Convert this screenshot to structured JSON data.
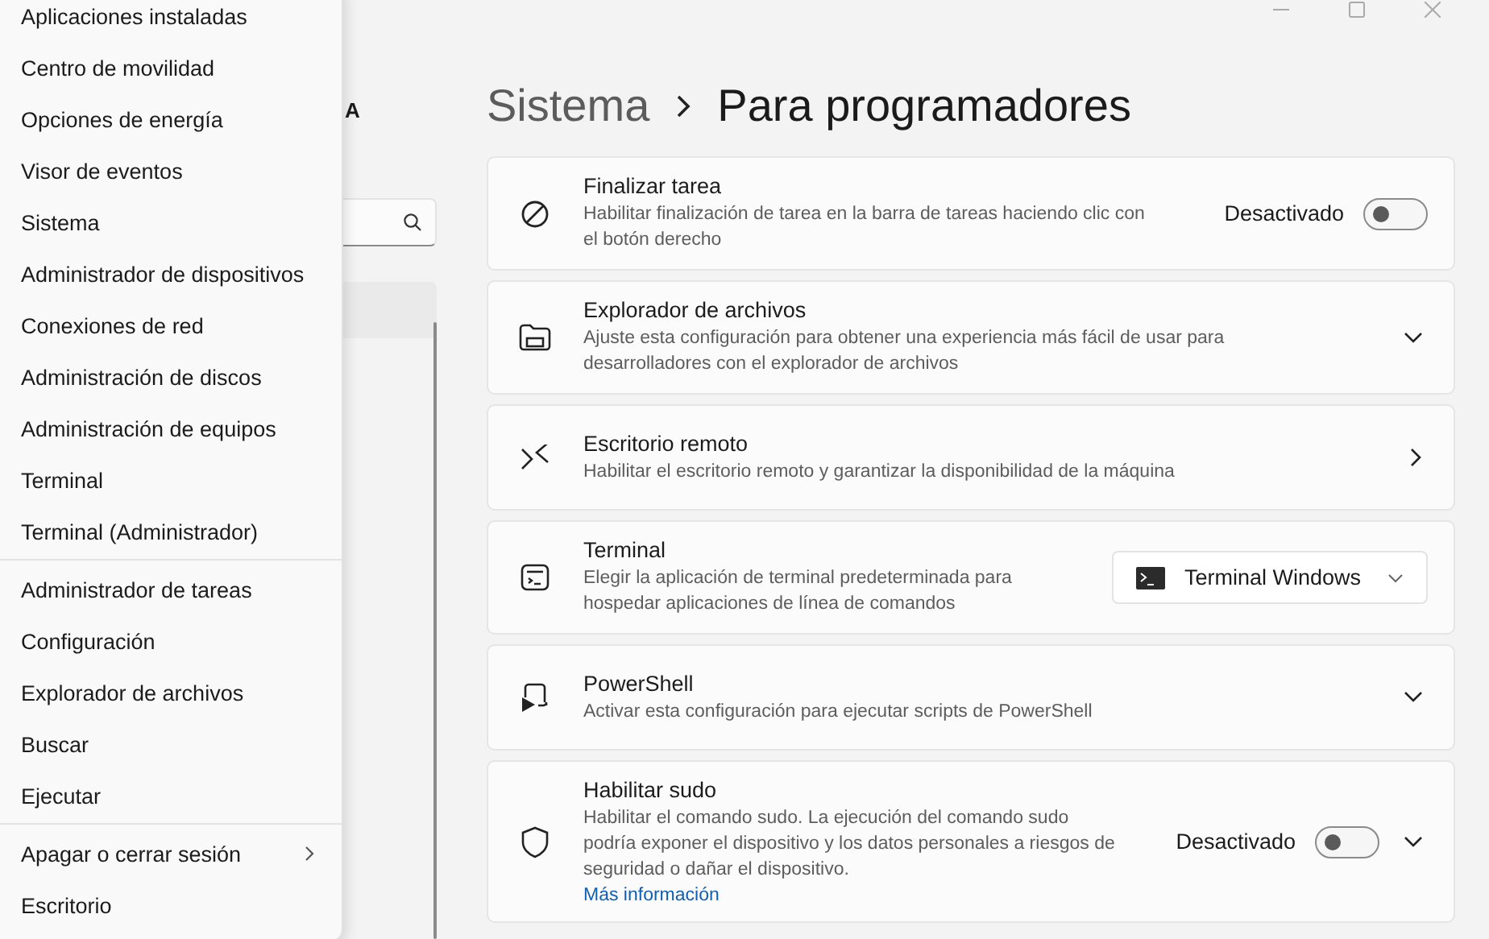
{
  "menu": {
    "groups": [
      {
        "items": [
          {
            "label": "Aplicaciones instaladas"
          },
          {
            "label": "Centro de movilidad"
          },
          {
            "label": "Opciones de energía"
          },
          {
            "label": "Visor de eventos"
          },
          {
            "label": "Sistema"
          },
          {
            "label": "Administrador de dispositivos"
          },
          {
            "label": "Conexiones de red"
          },
          {
            "label": "Administración de discos"
          },
          {
            "label": "Administración de equipos"
          },
          {
            "label": "Terminal"
          },
          {
            "label": "Terminal (Administrador)"
          }
        ]
      },
      {
        "items": [
          {
            "label": "Administrador de tareas"
          },
          {
            "label": "Configuración"
          },
          {
            "label": "Explorador de archivos"
          },
          {
            "label": "Buscar"
          },
          {
            "label": "Ejecutar"
          }
        ]
      },
      {
        "items": [
          {
            "label": "Apagar o cerrar sesión",
            "submenu": true
          },
          {
            "label": "Escritorio"
          }
        ]
      }
    ]
  },
  "sidebar": {
    "user_name": "A"
  },
  "breadcrumb": [
    {
      "label": "Sistema",
      "current": false
    },
    {
      "label": "Para programadores",
      "current": true
    }
  ],
  "cards": [
    {
      "title": "Finalizar tarea",
      "description": "Habilitar finalización de tarea en la barra de tareas haciendo clic con el botón derecho",
      "toggle": {
        "label": "Desactivado",
        "on": false
      }
    },
    {
      "title": "Explorador de archivos",
      "description": "Ajuste esta configuración para obtener una experiencia más fácil de usar para desarrolladores con el explorador de archivos",
      "expandable": true
    },
    {
      "title": "Escritorio remoto",
      "description": "Habilitar el escritorio remoto y garantizar la disponibilidad de la máquina",
      "navigates": true
    },
    {
      "title": "Terminal",
      "description": "Elegir la aplicación de terminal predeterminada para hospedar aplicaciones de línea de comandos",
      "dropdown": {
        "value": "Terminal Windows"
      }
    },
    {
      "title": "PowerShell",
      "description": "Activar esta configuración para ejecutar scripts de PowerShell",
      "expandable": true
    },
    {
      "title": "Habilitar sudo",
      "description": "Habilitar el comando sudo. La ejecución del comando sudo podría exponer el dispositivo y los datos personales a riesgos de seguridad o dañar el dispositivo.",
      "link": "Más información",
      "toggle": {
        "label": "Desactivado",
        "on": false
      },
      "expandable": true
    }
  ]
}
